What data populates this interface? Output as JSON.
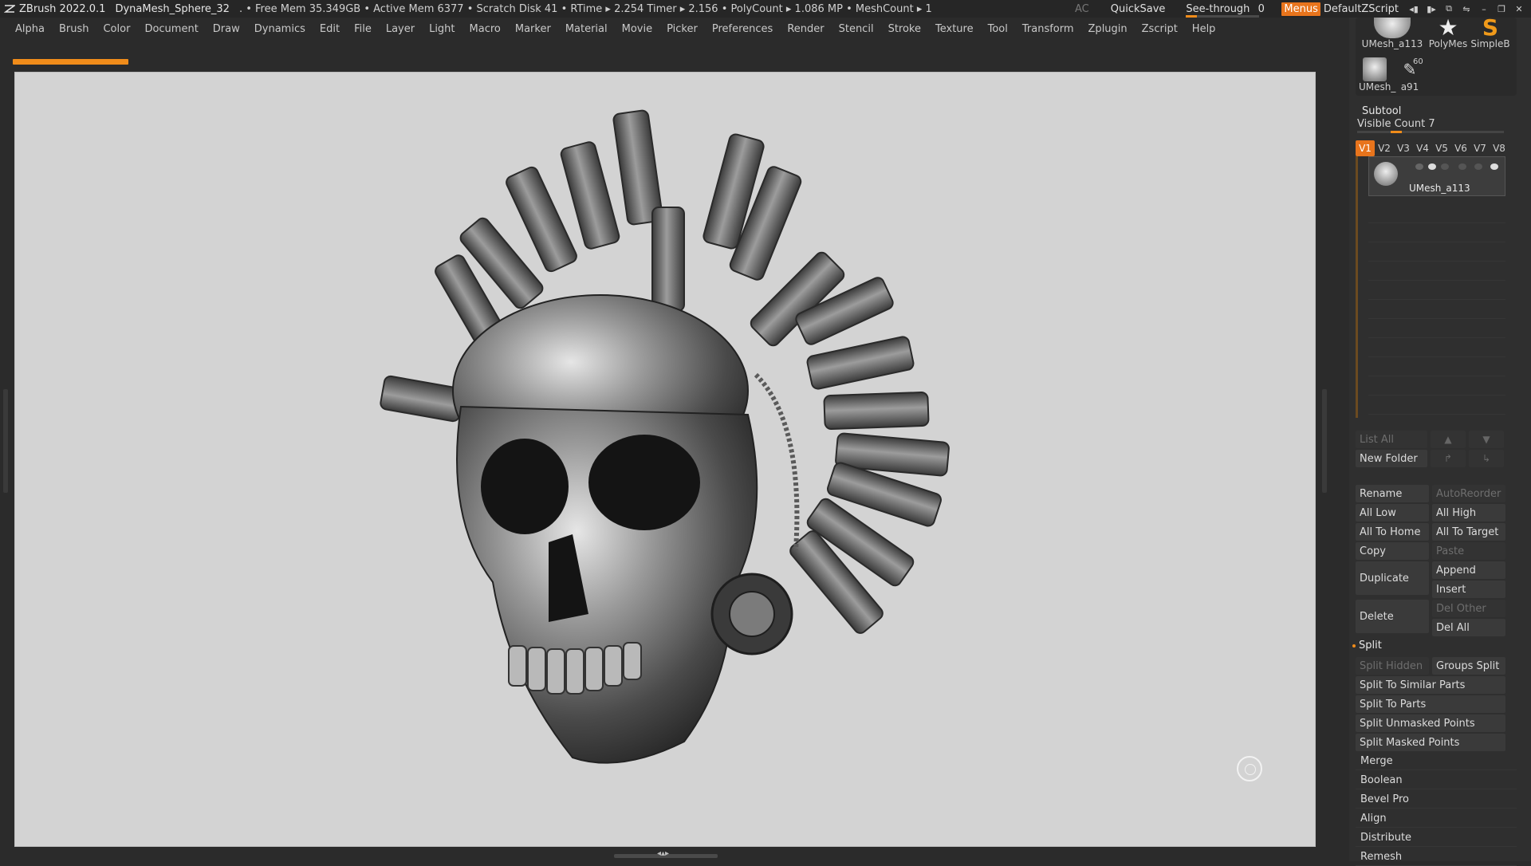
{
  "titlebar": {
    "app": "ZBrush 2022.0.1",
    "document": "DynaMesh_Sphere_32",
    "stats": ". • Free Mem 35.349GB • Active Mem 6377 • Scratch Disk 41 • RTime ▸ 2.254 Timer ▸ 2.156 • PolyCount ▸ 1.086 MP • MeshCount ▸ 1",
    "ac": "AC",
    "quicksave": "QuickSave",
    "see_through_label": "See-through",
    "see_through_value": "0",
    "menus": "Menus",
    "default_zscript": "DefaultZScript"
  },
  "menubar": [
    "Alpha",
    "Brush",
    "Color",
    "Document",
    "Draw",
    "Dynamics",
    "Edit",
    "File",
    "Layer",
    "Light",
    "Macro",
    "Marker",
    "Material",
    "Movie",
    "Picker",
    "Preferences",
    "Render",
    "Stencil",
    "Stroke",
    "Texture",
    "Tool",
    "Transform",
    "Zplugin",
    "Zscript",
    "Help"
  ],
  "tool_thumbs": [
    {
      "label": "UMesh_a113"
    },
    {
      "label": "PolyMes"
    },
    {
      "label": "SimpleB"
    },
    {
      "label": "UMesh_"
    },
    {
      "label": "a91",
      "badge": "60"
    }
  ],
  "subtool": {
    "title": "Subtool",
    "visible_count": "Visible Count 7",
    "tabs": [
      "V1",
      "V2",
      "V3",
      "V4",
      "V5",
      "V6",
      "V7",
      "V8"
    ],
    "active_tab": "V1",
    "item_name": "UMesh_a113",
    "list_all": "List All",
    "new_folder": "New Folder",
    "rename": "Rename",
    "auto_reorder": "AutoReorder",
    "all_low": "All Low",
    "all_high": "All High",
    "all_to_home": "All To Home",
    "all_to_target": "All To Target",
    "copy": "Copy",
    "paste": "Paste",
    "duplicate": "Duplicate",
    "append": "Append",
    "insert": "Insert",
    "delete": "Delete",
    "del_other": "Del Other",
    "del_all": "Del All",
    "split_section": "Split",
    "split_hidden": "Split Hidden",
    "groups_split": "Groups Split",
    "split_similar": "Split To Similar Parts",
    "split_parts": "Split To Parts",
    "split_unmasked": "Split Unmasked Points",
    "split_masked": "Split Masked Points",
    "categories": [
      "Merge",
      "Boolean",
      "Bevel Pro",
      "Align",
      "Distribute",
      "Remesh"
    ]
  },
  "colors": {
    "accent": "#e8741c",
    "canvas_bg": "#d3d3d3",
    "ui_bg": "#2b2b2b"
  }
}
